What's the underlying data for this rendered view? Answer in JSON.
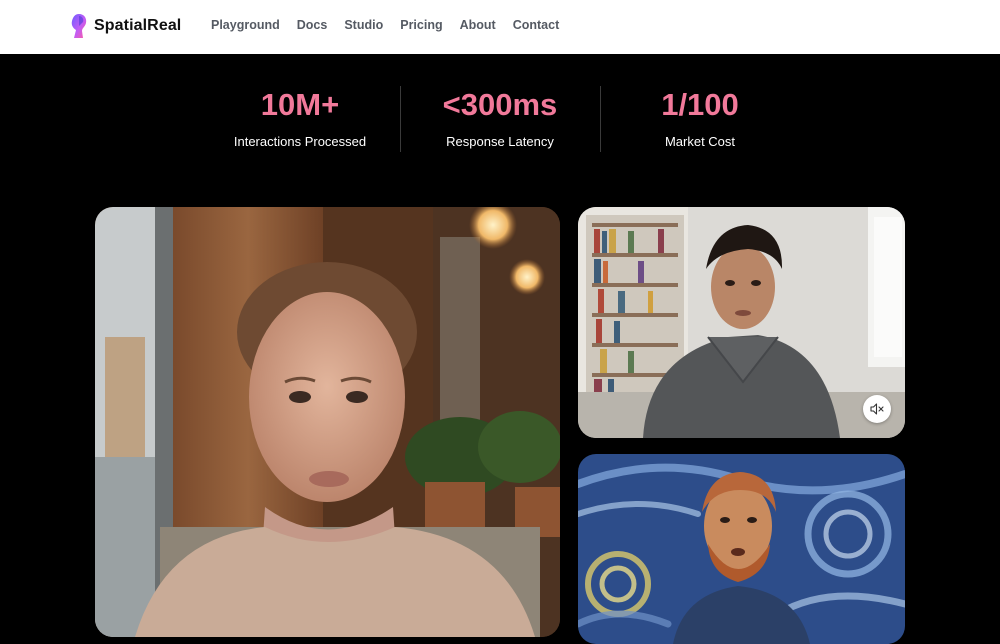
{
  "brand": {
    "name": "SpatialReal",
    "icon": "spatialreal-logo-icon",
    "gradient": [
      "#7b5cff",
      "#ff5ca8"
    ]
  },
  "nav": {
    "items": [
      {
        "label": "Playground"
      },
      {
        "label": "Docs"
      },
      {
        "label": "Studio"
      },
      {
        "label": "Pricing"
      },
      {
        "label": "About"
      },
      {
        "label": "Contact"
      }
    ]
  },
  "stats": [
    {
      "value": "10M+",
      "label": "Interactions Processed"
    },
    {
      "value": "<300ms",
      "label": "Response Latency"
    },
    {
      "value": "1/100",
      "label": "Market Cost"
    }
  ],
  "colors": {
    "accent": "#f1799a",
    "background": "#000000"
  },
  "videos": {
    "main": {
      "subject": "woman-avatar"
    },
    "top": {
      "subject": "man-avatar",
      "control_icon": "speaker-muted-icon"
    },
    "bottom": {
      "subject": "van-gogh-avatar"
    }
  }
}
